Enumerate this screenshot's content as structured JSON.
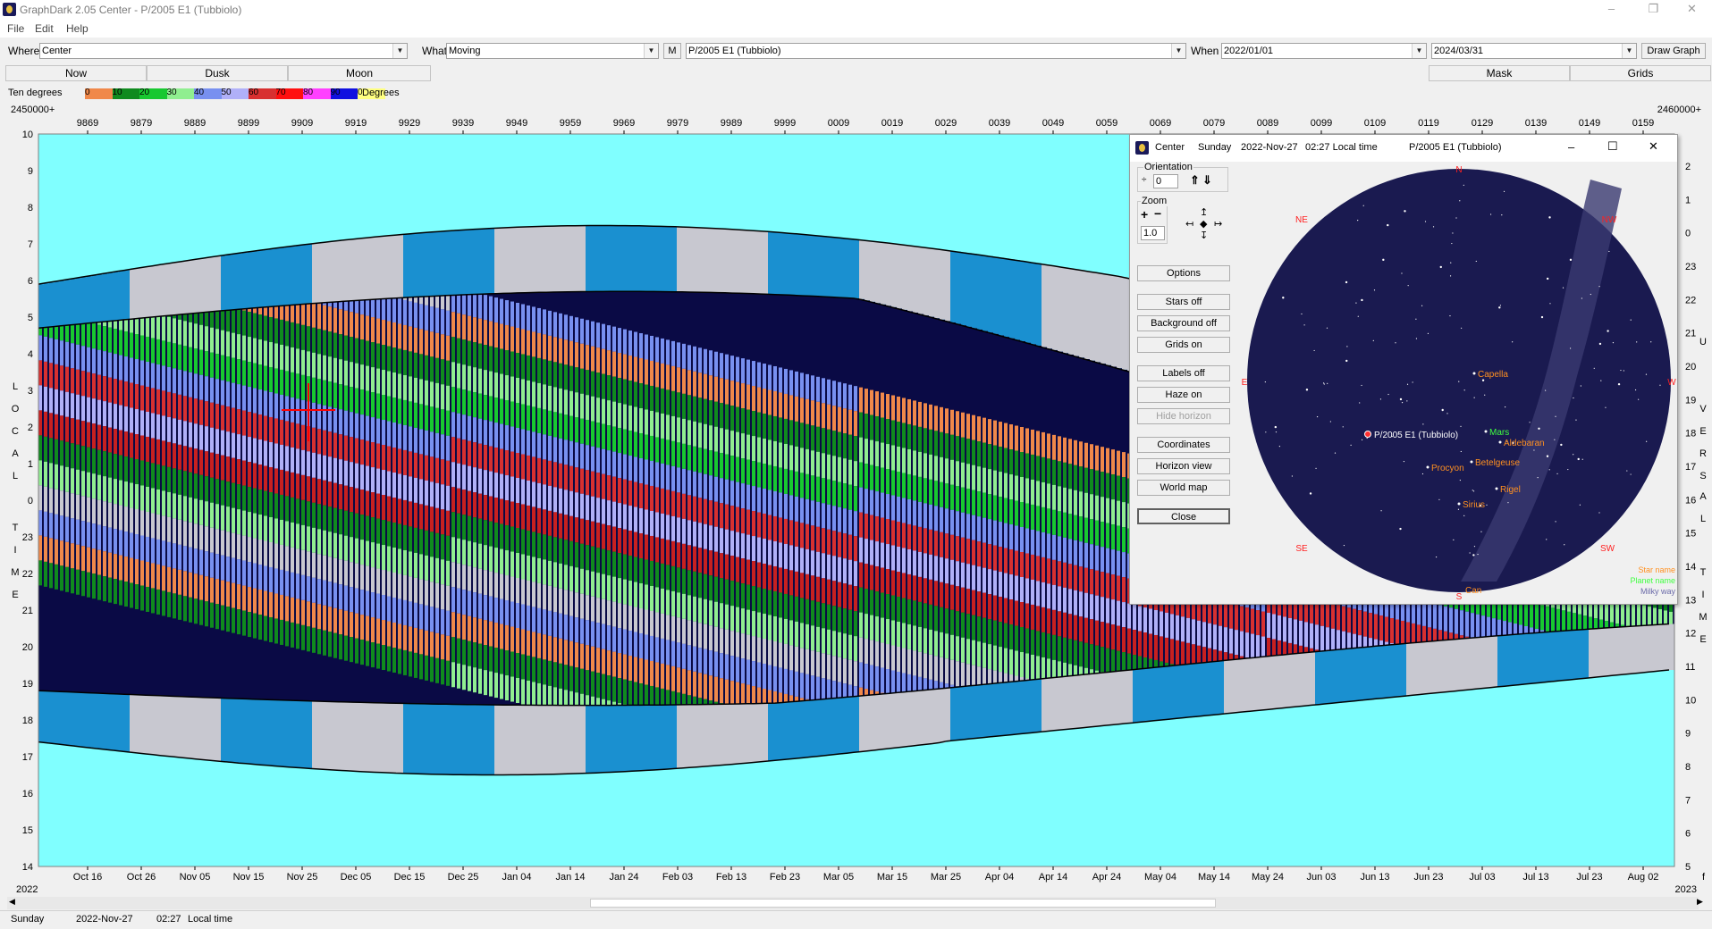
{
  "window": {
    "title": "GraphDark 2.05  Center  -  P/2005 E1 (Tubbiolo)",
    "minimize": "–",
    "restore": "❐",
    "close": "✕"
  },
  "menu": [
    "File",
    "Edit",
    "Help"
  ],
  "toolbar": {
    "where_label": "Where",
    "where_value": "Center",
    "what_label": "What",
    "what_value": "Moving",
    "m_button": "M",
    "object_value": "P/2005 E1 (Tubbiolo)",
    "when_label": "When",
    "start_date": "2022/01/01",
    "end_date": "2024/03/31",
    "draw_graph": "Draw Graph"
  },
  "tabs": {
    "now": "Now",
    "dusk": "Dusk",
    "moon": "Moon",
    "mask": "Mask",
    "grids": "Grids"
  },
  "legend": {
    "label": "Ten degrees",
    "items": [
      {
        "value": "0",
        "color": "#f0884a"
      },
      {
        "value": "10",
        "color": "#0f8a1e"
      },
      {
        "value": "20",
        "color": "#18c830"
      },
      {
        "value": "30",
        "color": "#90ee90"
      },
      {
        "value": "40",
        "color": "#7890f0"
      },
      {
        "value": "50",
        "color": "#b0b0f8"
      },
      {
        "value": "60",
        "color": "#d83030"
      },
      {
        "value": "70",
        "color": "#ff1010"
      },
      {
        "value": "80",
        "color": "#ff40ff"
      },
      {
        "value": "90",
        "color": "#1010e0"
      },
      {
        "value": "0",
        "color": "#ffff80"
      }
    ],
    "suffix": "Degrees"
  },
  "chart": {
    "jd_left": "2450000+",
    "jd_right": "2460000+",
    "jd_ticks": [
      "9869",
      "9879",
      "9889",
      "9899",
      "9909",
      "9919",
      "9929",
      "9939",
      "9949",
      "9959",
      "9969",
      "9979",
      "9989",
      "9999",
      "0009",
      "0019",
      "0029",
      "0039",
      "0049",
      "0059",
      "0069",
      "0079",
      "0089",
      "0099",
      "0109",
      "0119",
      "0129",
      "0139",
      "0149",
      "0159"
    ],
    "date_ticks": [
      "Oct 16",
      "Oct 26",
      "Nov 05",
      "Nov 15",
      "Nov 25",
      "Dec 05",
      "Dec 15",
      "Dec 25",
      "Jan 04",
      "Jan 14",
      "Jan 24",
      "Feb 03",
      "Feb 13",
      "Feb 23",
      "Mar 05",
      "Mar 15",
      "Mar 25",
      "Apr 04",
      "Apr 14",
      "Apr 24",
      "May 04",
      "May 14",
      "May 24",
      "Jun 03",
      "Jun 13",
      "Jun 23",
      "Jul 03",
      "Jul 13",
      "Jul 23",
      "Aug 02"
    ],
    "year_left": "2022",
    "year_right": "2023",
    "left_hours": [
      "10",
      "9",
      "8",
      "7",
      "6",
      "5",
      "4",
      "3",
      "2",
      "1",
      "0",
      "23",
      "22",
      "21",
      "20",
      "19",
      "18",
      "17",
      "16",
      "15",
      "14"
    ],
    "right_hours": [
      "2",
      "1",
      "0",
      "23",
      "22",
      "21",
      "20",
      "19",
      "18",
      "17",
      "16",
      "15",
      "14",
      "13",
      "12",
      "11",
      "10",
      "9",
      "8",
      "7",
      "6",
      "5"
    ],
    "left_axis_title": "LOCAL TIME",
    "right_axis_title": "UT VERSAL TIME",
    "right_axis_letters": [
      "U",
      "V",
      "E",
      "R",
      "S",
      "A",
      "L",
      "T",
      "I",
      "M",
      "E"
    ],
    "left_axis_letters": [
      "L",
      "O",
      "C",
      "A",
      "L",
      "T",
      "I",
      "M",
      "E"
    ],
    "right_bottom": "f"
  },
  "sky": {
    "title_place": "Center",
    "title_day": "Sunday",
    "title_date": "2022-Nov-27",
    "title_time": "02:27 Local time",
    "title_object": "P/2005 E1 (Tubbiolo)",
    "orientation_label": "Orientation",
    "orientation_value": "0",
    "zoom_label": "Zoom",
    "zoom_value": "1.0",
    "buttons": {
      "options": "Options",
      "stars_off": "Stars off",
      "background_off": "Background off",
      "grids_on": "Grids on",
      "labels_off": "Labels off",
      "haze_on": "Haze on",
      "hide_horizon": "Hide horizon",
      "coordinates": "Coordinates",
      "horizon_view": "Horizon view",
      "world_map": "World map",
      "close": "Close"
    },
    "directions": {
      "n": "N",
      "ne": "NE",
      "nw": "NW",
      "e": "E",
      "w": "W",
      "se": "SE",
      "sw": "SW",
      "s": "S"
    },
    "labels": {
      "comet": "P/2005 E1 (Tubbiolo)",
      "capella": "Capella",
      "mars": "Mars",
      "aldebaran": "Aldebaran",
      "procyon": "Procyon",
      "betelgeuse": "Betelgeuse",
      "rigel": "Rigel",
      "sirius": "Sirius",
      "canopus": "Can",
      "star_name": "Star name",
      "planet_name": "Planet name",
      "milky_way": "Milky way"
    }
  },
  "status": {
    "day": "Sunday",
    "date": "2022-Nov-27",
    "time": "02:27",
    "tz": "Local time"
  },
  "colors": {
    "daylight": "#80ffff",
    "night": "#0a0a45",
    "moon_blue": "#1a90d0",
    "moon_gray": "#c8c8d0",
    "sky_disk": "#1a1a50",
    "star_label": "#ff9020",
    "planet_label": "#40ff40",
    "direction": "#ff2020"
  }
}
